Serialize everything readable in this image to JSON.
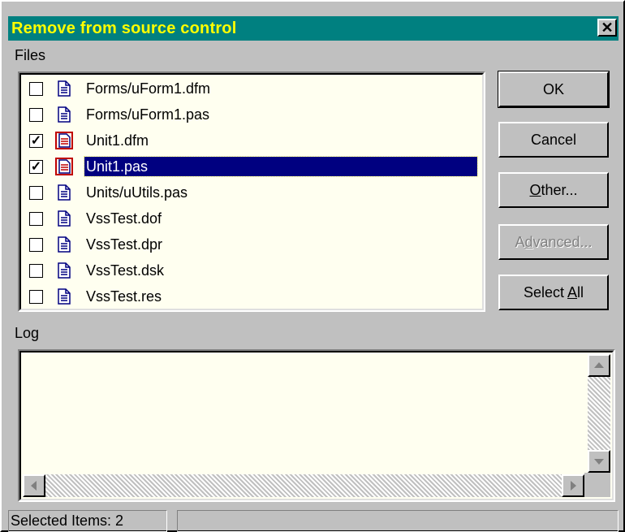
{
  "window": {
    "title": "Remove from source control",
    "close_glyph": "✕"
  },
  "files": {
    "label": "Files",
    "items": [
      {
        "name": "Forms/uForm1.dfm",
        "checked": false,
        "icon": "document-icon"
      },
      {
        "name": "Forms/uForm1.pas",
        "checked": false,
        "icon": "document-icon"
      },
      {
        "name": "Unit1.dfm",
        "checked": true,
        "icon": "modified-document-icon"
      },
      {
        "name": "Unit1.pas",
        "checked": true,
        "icon": "modified-document-icon",
        "selected": true
      },
      {
        "name": "Units/uUtils.pas",
        "checked": false,
        "icon": "document-icon"
      },
      {
        "name": "VssTest.dof",
        "checked": false,
        "icon": "document-icon"
      },
      {
        "name": "VssTest.dpr",
        "checked": false,
        "icon": "document-icon"
      },
      {
        "name": "VssTest.dsk",
        "checked": false,
        "icon": "document-icon"
      },
      {
        "name": "VssTest.res",
        "checked": false,
        "icon": "document-icon"
      }
    ]
  },
  "buttons": {
    "ok": "OK",
    "cancel": "Cancel",
    "other_pre": "",
    "other_acc": "O",
    "other_post": "ther...",
    "advanced_pre": "A",
    "advanced_acc": "d",
    "advanced_post": "vanced...",
    "selectall_pre": "Select ",
    "selectall_acc": "A",
    "selectall_post": "ll"
  },
  "log": {
    "label": "Log",
    "content": ""
  },
  "status": {
    "selected_items": "Selected Items: 2"
  },
  "colors": {
    "title_bg": "#008080",
    "title_fg": "#ffff00",
    "selection": "#000080",
    "list_bg": "#fffff0"
  }
}
